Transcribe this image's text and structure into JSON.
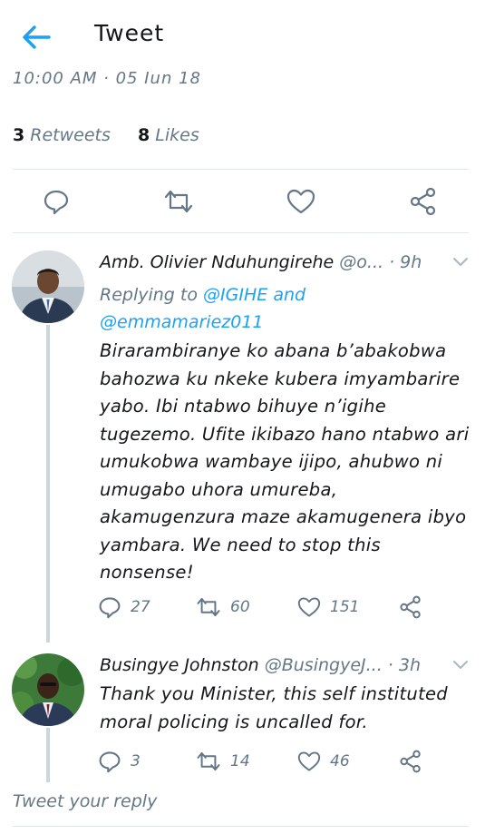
{
  "header": {
    "title": "Tweet",
    "back_icon": "arrow-left-icon",
    "accent": "#1da1f2"
  },
  "tweet": {
    "timestamp": "10:00 AM · 05 Jun 18",
    "retweets_count": "3",
    "retweets_label": "Retweets",
    "likes_count": "8",
    "likes_label": "Likes",
    "actions": [
      "reply-icon",
      "retweet-icon",
      "like-icon",
      "share-icon"
    ]
  },
  "replies": [
    {
      "name": "Amb. Olivier Nduhungirehe",
      "handle": "@o...",
      "time": "· 9h",
      "replying_prefix": "Replying to",
      "replying_mention_1": "@IGIHE",
      "replying_and": "and",
      "replying_mention_2": "@emmamariez011",
      "text_lines": [
        "Birarambiranye ko abana b’abakobwa",
        "bahozwa ku nkeke kubera imyambarire",
        "yabo. Ibi ntabwo bihuye n’igihe",
        "tugezemo. Ufite ikibazo hano ntabwo ari",
        "umukobwa wambaye ijipo, ahubwo ni",
        "umugabo uhora umureba,",
        "akamugenzura maze akamugenera ibyo",
        "yambara. We need to stop this",
        "nonsense!"
      ],
      "reply_count": "27",
      "retweet_count": "60",
      "like_count": "151"
    },
    {
      "name": "Busingye Johnston",
      "handle": "@BusingyeJ...",
      "time": "· 3h",
      "text_lines": [
        "Thank you Minister, this self instituted",
        "moral policing is uncalled for."
      ],
      "reply_count": "3",
      "retweet_count": "14",
      "like_count": "46"
    }
  ],
  "compose": {
    "placeholder": "Tweet your reply"
  }
}
